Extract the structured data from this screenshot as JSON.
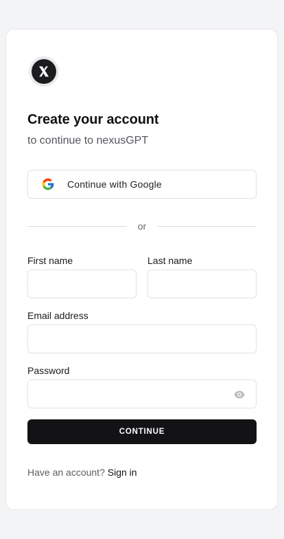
{
  "header": {
    "logo_icon": "x-logo-icon",
    "title": "Create your account",
    "subtitle": "to continue to nexusGPT"
  },
  "social": {
    "google_label": "Continue with Google",
    "google_icon": "google-icon"
  },
  "divider": {
    "text": "or"
  },
  "form": {
    "first_name_label": "First name",
    "first_name_value": "",
    "last_name_label": "Last name",
    "last_name_value": "",
    "email_label": "Email address",
    "email_value": "",
    "password_label": "Password",
    "password_value": "",
    "password_toggle_icon": "eye-icon",
    "submit_label": "CONTINUE"
  },
  "footer": {
    "prompt": "Have an account?",
    "link": "Sign in"
  },
  "colors": {
    "page_background": "#f3f4f6",
    "card_background": "#ffffff",
    "primary_button": "#131316",
    "border": "#e2e2e6"
  }
}
